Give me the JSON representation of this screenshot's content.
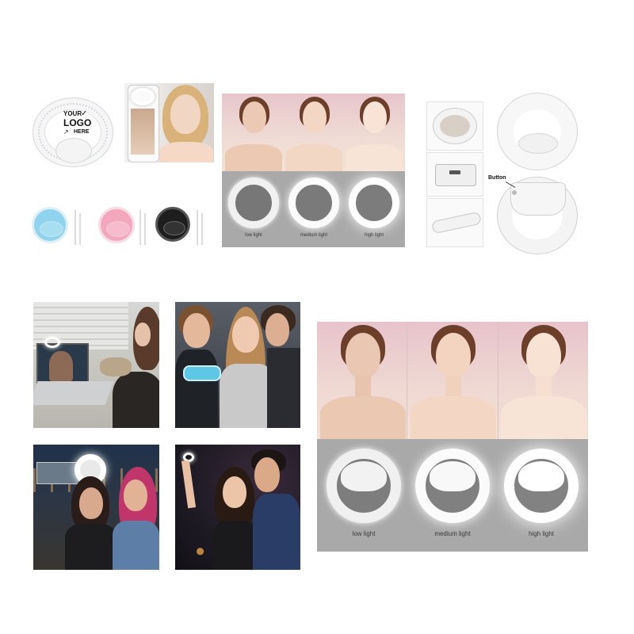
{
  "logo_ring": {
    "line1": "YOUR",
    "line2": "LOGO",
    "line3": "HERE"
  },
  "comparison_small": {
    "labels": [
      "low light",
      "medium light",
      "high light"
    ]
  },
  "comparison_large": {
    "labels": [
      "low light",
      "medium light",
      "high light"
    ]
  },
  "detail": {
    "button_label": "Button"
  },
  "colors": {
    "blue_ring": "#8fd3ee",
    "pink_ring": "#f3a7bd",
    "black_ring": "#1e1e1e",
    "panel_grey": "#a9a9a9",
    "panel_pink": "#e9c9cf"
  }
}
